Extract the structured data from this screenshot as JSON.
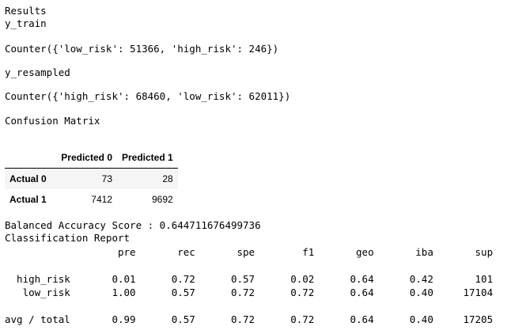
{
  "output": {
    "line_results": "Results",
    "line_y_train": "y_train",
    "line_counter_train": "Counter({'low_risk': 51366, 'high_risk': 246})",
    "line_y_resampled": "y_resampled",
    "line_counter_resampled": "Counter({'high_risk': 68460, 'low_risk': 62011})",
    "line_confusion_matrix": "Confusion Matrix",
    "line_balanced_accuracy": "Balanced Accuracy Score : 0.644711676499736",
    "classification_report": [
      "Classification Report",
      "                   pre       rec       spe        f1       geo       iba       sup",
      "",
      "  high_risk       0.01      0.72      0.57      0.02      0.64      0.42       101",
      "   low_risk       1.00      0.57      0.72      0.72      0.64      0.40     17104",
      "",
      "avg / total       0.99      0.57      0.72      0.72      0.64      0.40     17205"
    ]
  },
  "confusion_table": {
    "header_corner": "",
    "col0": "Predicted 0",
    "col1": "Predicted 1",
    "rows": [
      {
        "label": "Actual 0",
        "v0": "73",
        "v1": "28"
      },
      {
        "label": "Actual 1",
        "v0": "7412",
        "v1": "9692"
      }
    ]
  }
}
